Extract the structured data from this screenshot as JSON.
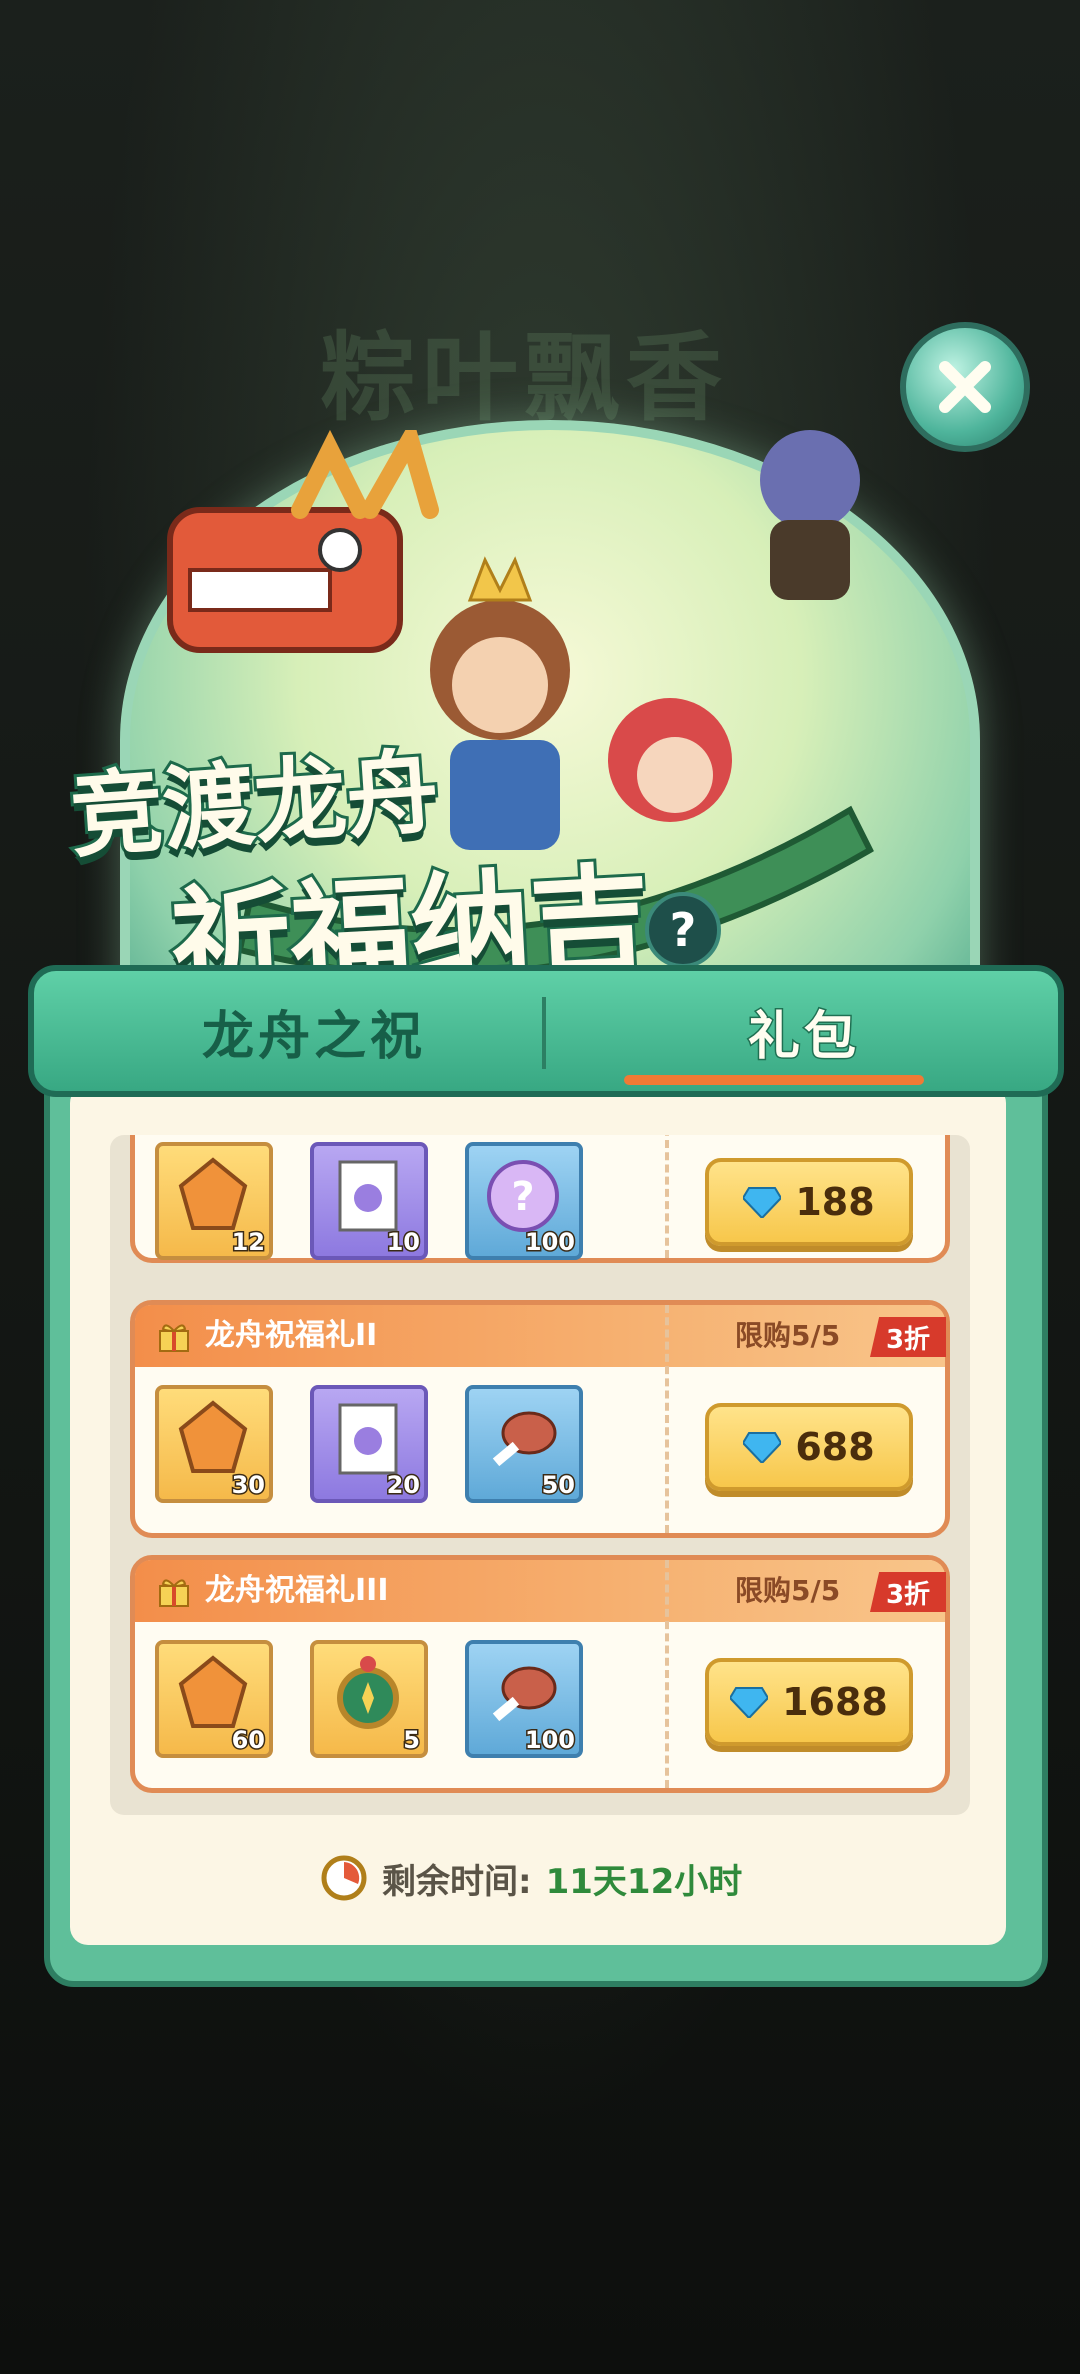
{
  "hero": {
    "background_title": "粽叶飘香",
    "title_line1": "竞渡龙舟",
    "title_line2": "祈福纳吉"
  },
  "tabs": [
    {
      "label": "龙舟之祝",
      "active": false
    },
    {
      "label": "礼包",
      "active": true
    }
  ],
  "packs": [
    {
      "partial": true,
      "items": [
        {
          "icon": "amber-crystal-icon",
          "qty": "12",
          "style": "gold"
        },
        {
          "icon": "integral-scroll-icon",
          "qty": "10",
          "style": "purple"
        },
        {
          "icon": "mystery-orb-icon",
          "qty": "100",
          "style": "blue"
        }
      ],
      "price": "188"
    },
    {
      "name": "龙舟祝福礼II",
      "limit": "限购5/5",
      "discount": "3折",
      "items": [
        {
          "icon": "amber-crystal-icon",
          "qty": "30",
          "style": "gold"
        },
        {
          "icon": "integral-scroll-icon",
          "qty": "20",
          "style": "purple"
        },
        {
          "icon": "meat-icon",
          "qty": "50",
          "style": "blue"
        }
      ],
      "price": "688"
    },
    {
      "name": "龙舟祝福礼III",
      "limit": "限购5/5",
      "discount": "3折",
      "items": [
        {
          "icon": "amber-crystal-icon",
          "qty": "60",
          "style": "gold"
        },
        {
          "icon": "compass-icon",
          "qty": "5",
          "style": "gold"
        },
        {
          "icon": "meat-icon",
          "qty": "100",
          "style": "blue"
        }
      ],
      "price": "1688"
    }
  ],
  "timer": {
    "label": "剩余时间:",
    "value": "11天12小时"
  },
  "colors": {
    "panel_green": "#5fbf9a",
    "card_border": "#e08b55",
    "discount_red": "#d73a2b",
    "price_gold": "#f7c74b",
    "timer_green": "#2f8a3b"
  }
}
